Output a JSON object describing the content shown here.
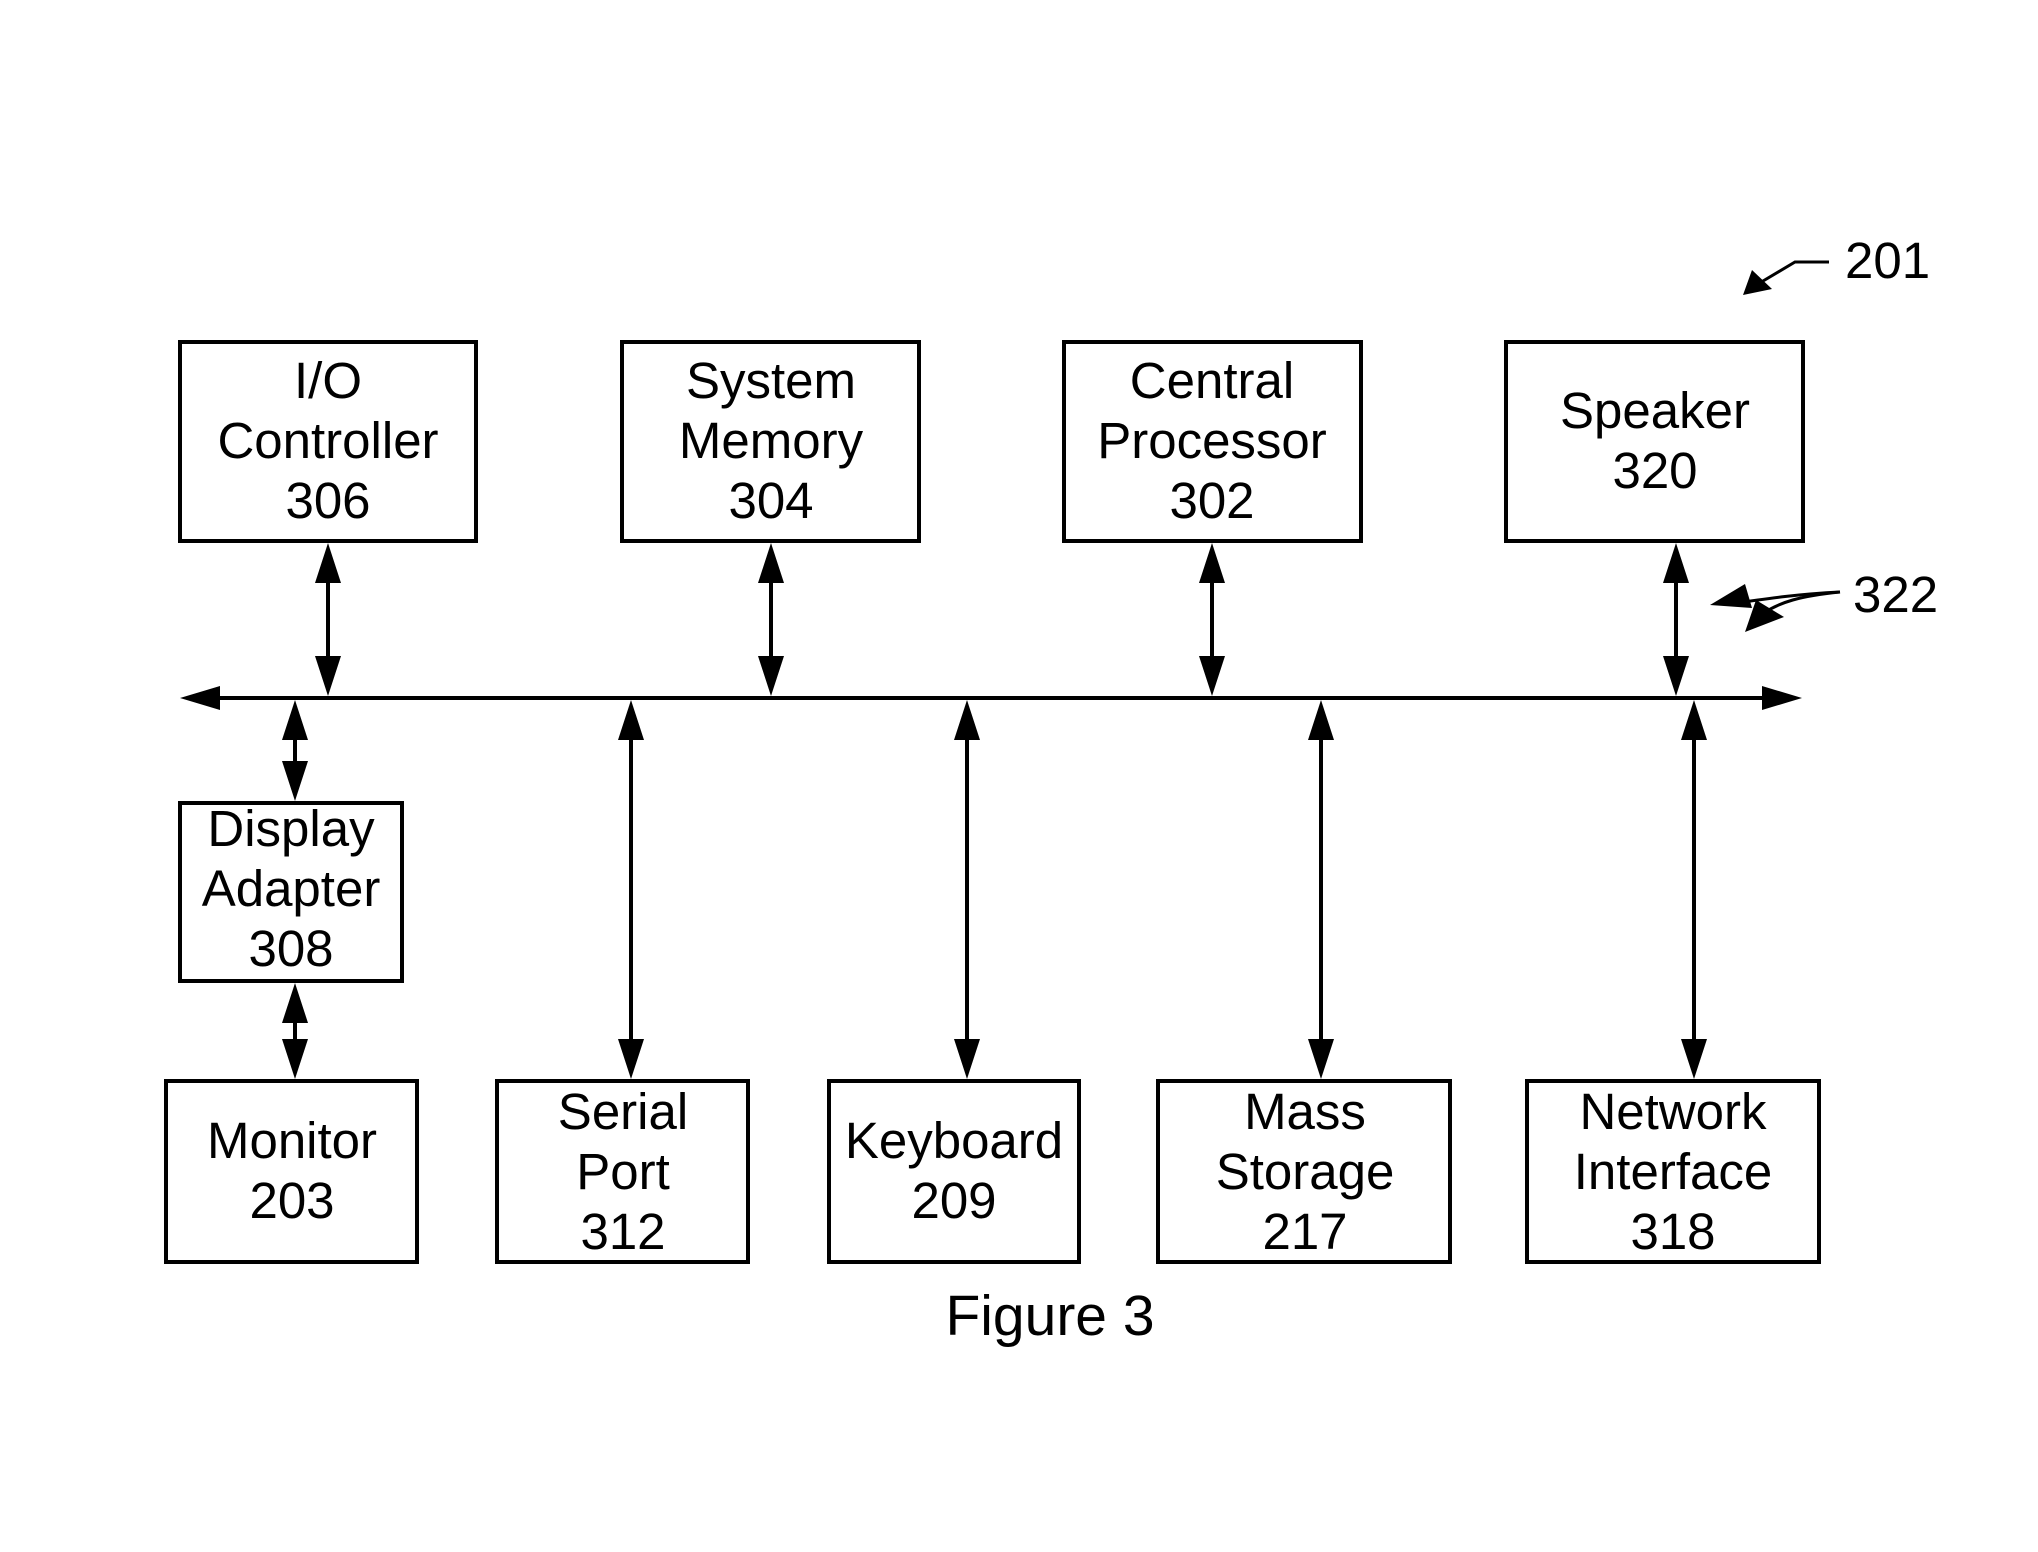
{
  "figure": {
    "caption": "Figure 3",
    "system_ref": "201",
    "bus_ref": "322"
  },
  "components": {
    "io_controller": {
      "lines": [
        "I/O",
        "Controller",
        "306"
      ]
    },
    "system_memory": {
      "lines": [
        "System",
        "Memory",
        "304"
      ]
    },
    "central_processor": {
      "lines": [
        "Central",
        "Processor",
        "302"
      ]
    },
    "speaker": {
      "lines": [
        "Speaker",
        "320"
      ]
    },
    "display_adapter": {
      "lines": [
        "Display",
        "Adapter",
        "308"
      ]
    },
    "monitor": {
      "lines": [
        "Monitor",
        "203"
      ]
    },
    "serial_port": {
      "lines": [
        "Serial",
        "Port",
        "312"
      ]
    },
    "keyboard": {
      "lines": [
        "Keyboard",
        "209"
      ]
    },
    "mass_storage": {
      "lines": [
        "Mass",
        "Storage",
        "217"
      ]
    },
    "network_interface": {
      "lines": [
        "Network",
        "Interface",
        "318"
      ]
    }
  },
  "connections": [
    {
      "from": "io_controller",
      "to": "bus",
      "direction": "bidirectional"
    },
    {
      "from": "system_memory",
      "to": "bus",
      "direction": "bidirectional"
    },
    {
      "from": "central_processor",
      "to": "bus",
      "direction": "bidirectional"
    },
    {
      "from": "speaker",
      "to": "bus",
      "direction": "bidirectional"
    },
    {
      "from": "display_adapter",
      "to": "bus",
      "direction": "bidirectional"
    },
    {
      "from": "display_adapter",
      "to": "monitor",
      "direction": "bidirectional"
    },
    {
      "from": "serial_port",
      "to": "bus",
      "direction": "bidirectional"
    },
    {
      "from": "keyboard",
      "to": "bus",
      "direction": "bidirectional"
    },
    {
      "from": "mass_storage",
      "to": "bus",
      "direction": "bidirectional"
    },
    {
      "from": "network_interface",
      "to": "bus",
      "direction": "bidirectional"
    }
  ]
}
